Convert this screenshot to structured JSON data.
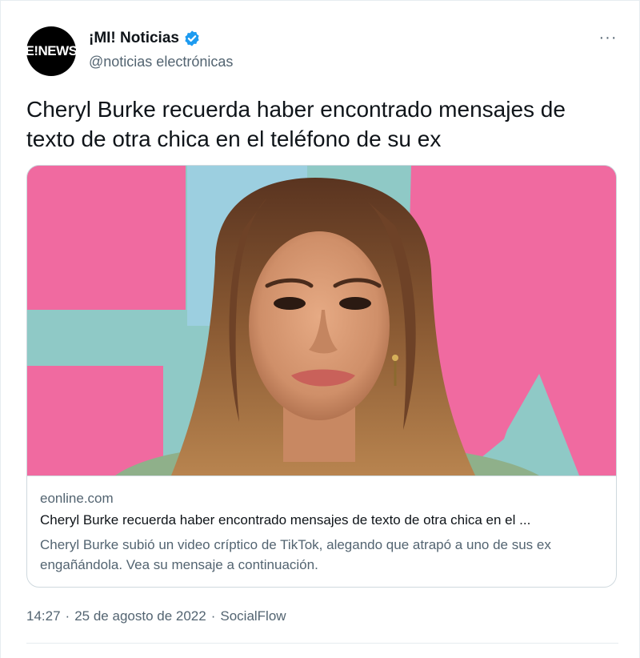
{
  "account": {
    "avatar_text": "E!NEWS",
    "name": "¡MI! Noticias",
    "handle": "@noticias electrónicas",
    "verified": true
  },
  "more_icon": "more-options-icon",
  "tweet_text": "Cheryl Burke recuerda haber encontrado mensajes de texto de otra chica en el teléfono de su ex",
  "card": {
    "domain": "eonline.com",
    "title": "Cheryl Burke recuerda haber encontrado mensajes de texto de otra chica en el ...",
    "description": "Cheryl Burke subió un video críptico de TikTok, alegando que atrapó a uno de sus ex engañándola. Vea su mensaje a continuación."
  },
  "footer": {
    "time": "14:27",
    "sep1": "·",
    "date": "25 de agosto de 2022",
    "sep2": "·",
    "source": "SocialFlow"
  },
  "colors": {
    "verified_blue": "#1d9bf0",
    "secondary_text": "#536471",
    "pink": "#f06aa0",
    "teal": "#8fc9c6"
  }
}
